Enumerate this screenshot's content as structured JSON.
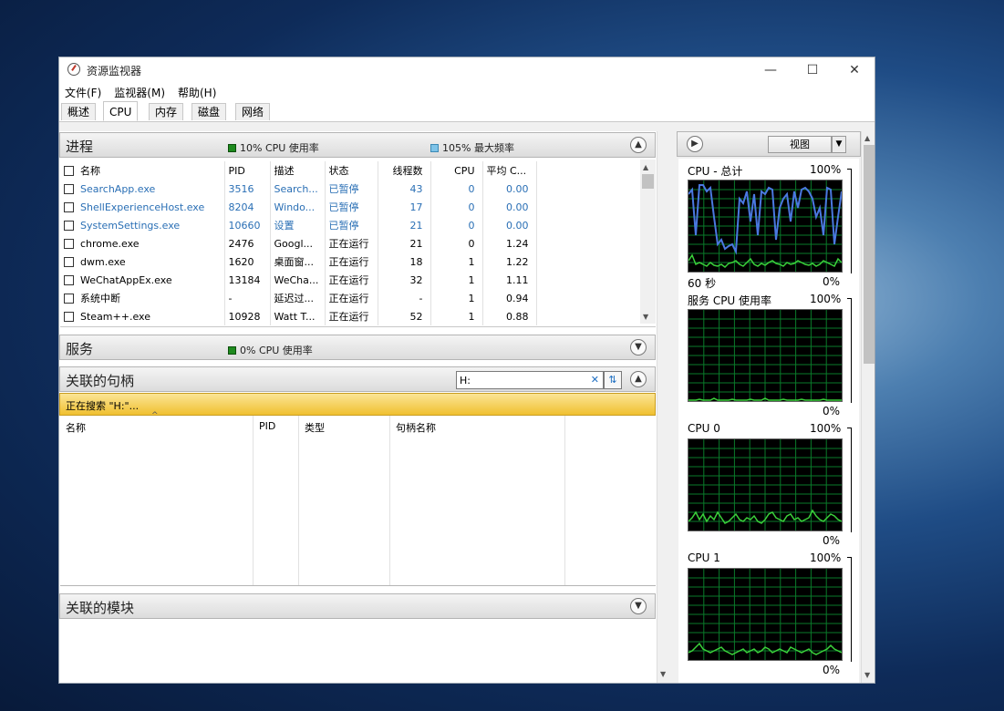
{
  "window": {
    "title": "资源监视器",
    "controls": {
      "minimize": "—",
      "maximize": "☐",
      "close": "✕"
    }
  },
  "menu": [
    "文件(F)",
    "监视器(M)",
    "帮助(H)"
  ],
  "tabs": [
    {
      "label": "概述",
      "active": false
    },
    {
      "label": "CPU",
      "active": true
    },
    {
      "label": "内存",
      "active": false
    },
    {
      "label": "磁盘",
      "active": false
    },
    {
      "label": "网络",
      "active": false
    }
  ],
  "processes": {
    "title": "进程",
    "usage_badge": "10% CPU 使用率",
    "freq_badge": "105% 最大频率",
    "columns": [
      "名称",
      "PID",
      "描述",
      "状态",
      "线程数",
      "CPU",
      "平均 C..."
    ],
    "rows": [
      {
        "name": "SearchApp.exe",
        "pid": "3516",
        "desc": "Search...",
        "status": "已暂停",
        "threads": "43",
        "cpu": "0",
        "avg": "0.00",
        "suspended": true
      },
      {
        "name": "ShellExperienceHost.exe",
        "pid": "8204",
        "desc": "Windo...",
        "status": "已暂停",
        "threads": "17",
        "cpu": "0",
        "avg": "0.00",
        "suspended": true
      },
      {
        "name": "SystemSettings.exe",
        "pid": "10660",
        "desc": "设置",
        "status": "已暂停",
        "threads": "21",
        "cpu": "0",
        "avg": "0.00",
        "suspended": true
      },
      {
        "name": "chrome.exe",
        "pid": "2476",
        "desc": "Googl...",
        "status": "正在运行",
        "threads": "21",
        "cpu": "0",
        "avg": "1.24",
        "suspended": false
      },
      {
        "name": "dwm.exe",
        "pid": "1620",
        "desc": "桌面窗...",
        "status": "正在运行",
        "threads": "18",
        "cpu": "1",
        "avg": "1.22",
        "suspended": false
      },
      {
        "name": "WeChatAppEx.exe",
        "pid": "13184",
        "desc": "WeCha...",
        "status": "正在运行",
        "threads": "32",
        "cpu": "1",
        "avg": "1.11",
        "suspended": false
      },
      {
        "name": "系统中断",
        "pid": "-",
        "desc": "延迟过...",
        "status": "正在运行",
        "threads": "-",
        "cpu": "1",
        "avg": "0.94",
        "suspended": false
      },
      {
        "name": "Steam++.exe",
        "pid": "10928",
        "desc": "Watt T...",
        "status": "正在运行",
        "threads": "52",
        "cpu": "1",
        "avg": "0.88",
        "suspended": false
      }
    ]
  },
  "services": {
    "title": "服务",
    "usage_badge": "0% CPU 使用率"
  },
  "handles": {
    "title": "关联的句柄",
    "search_value": "H:",
    "searching_text": "正在搜索 \"H:\"...",
    "columns": [
      "名称",
      "PID",
      "类型",
      "句柄名称"
    ]
  },
  "modules": {
    "title": "关联的模块"
  },
  "right_panel": {
    "view_label": "视图",
    "graphs": [
      {
        "title": "CPU - 总计",
        "max_label": "100%",
        "time_label": "60 秒",
        "min_label": "0%"
      },
      {
        "title": "服务 CPU 使用率",
        "max_label": "100%",
        "time_label": "",
        "min_label": "0%"
      },
      {
        "title": "CPU 0",
        "max_label": "100%",
        "time_label": "",
        "min_label": "0%"
      },
      {
        "title": "CPU 1",
        "max_label": "100%",
        "time_label": "",
        "min_label": "0%"
      }
    ],
    "cpu_total_usage": [
      85,
      90,
      40,
      95,
      95,
      88,
      92,
      60,
      30,
      35,
      25,
      28,
      30,
      22,
      80,
      75,
      88,
      55,
      85,
      40,
      88,
      85,
      92,
      90,
      35,
      70,
      80,
      85,
      55,
      88,
      70,
      90,
      92,
      88,
      80,
      60,
      70,
      40,
      92,
      90,
      30,
      60,
      88
    ],
    "cpu_total_freq": [
      12,
      18,
      8,
      10,
      8,
      6,
      10,
      7,
      6,
      8,
      5,
      9,
      10,
      12,
      8,
      6,
      10,
      14,
      8,
      6,
      9,
      7,
      10,
      12,
      9,
      8,
      6,
      10,
      8,
      9,
      12,
      10,
      8,
      7,
      9,
      6,
      8,
      12,
      10,
      8,
      6,
      14,
      10
    ],
    "service_usage": [
      1,
      1,
      1,
      2,
      1,
      1,
      1,
      3,
      1,
      1,
      1,
      1,
      2,
      1,
      1,
      1,
      1,
      2,
      1,
      1,
      1,
      3,
      1,
      1,
      1,
      1,
      2,
      1,
      1,
      1,
      1,
      2,
      1,
      1,
      1,
      1,
      1,
      2,
      1,
      1,
      1,
      1,
      1
    ],
    "cpu0_usage": [
      10,
      14,
      20,
      12,
      18,
      10,
      16,
      12,
      20,
      14,
      8,
      10,
      14,
      18,
      12,
      10,
      14,
      12,
      16,
      10,
      8,
      12,
      18,
      20,
      14,
      12,
      10,
      16,
      18,
      12,
      14,
      10,
      12,
      14,
      22,
      16,
      12,
      10,
      14,
      18,
      16,
      12,
      10
    ],
    "cpu1_usage": [
      8,
      10,
      14,
      18,
      12,
      10,
      8,
      10,
      12,
      14,
      10,
      8,
      6,
      8,
      10,
      12,
      8,
      10,
      12,
      8,
      10,
      14,
      12,
      8,
      10,
      12,
      10,
      8,
      14,
      12,
      10,
      8,
      10,
      12,
      8,
      6,
      8,
      10,
      12,
      16,
      12,
      10,
      8
    ]
  }
}
